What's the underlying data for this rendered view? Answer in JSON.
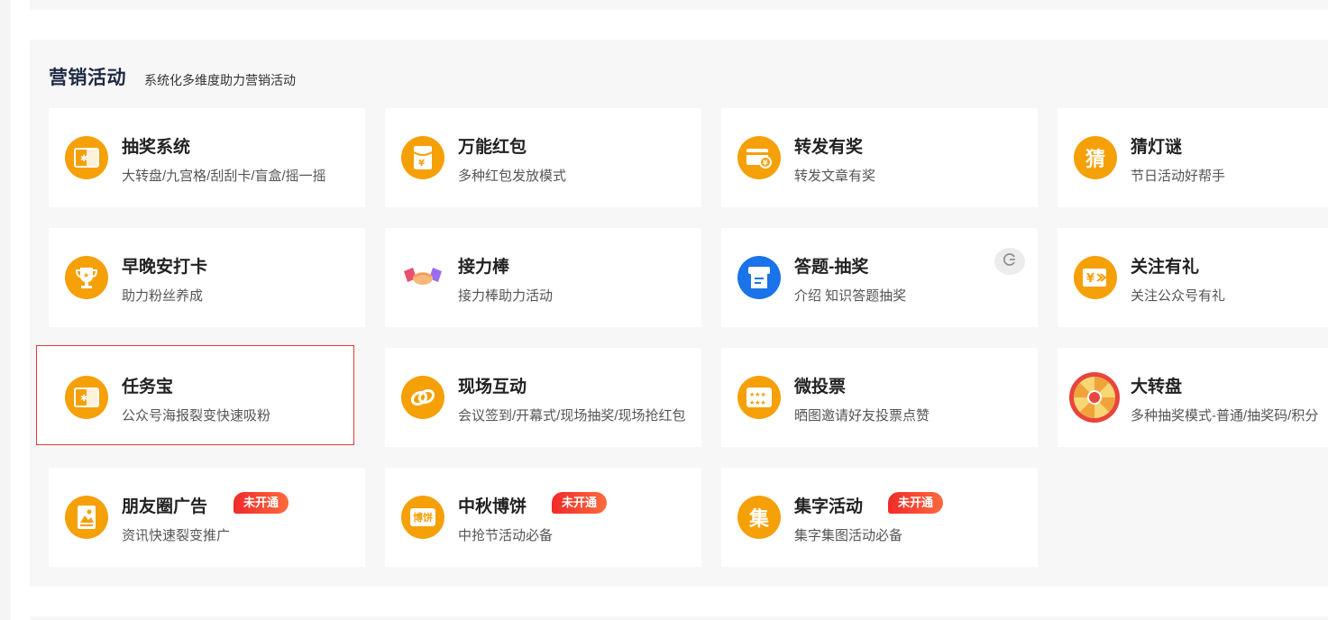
{
  "section": {
    "title": "营销活动",
    "subtitle": "系统化多维度助力营销活动"
  },
  "colors": {
    "accent": "#f5a007",
    "badge": "#f02a2a",
    "title_text": "#1f2a44"
  },
  "cards": [
    {
      "title": "抽奖系统",
      "desc": "大转盘/九宫格/刮刮卡/盲盒/摇一摇",
      "icon": "ticket-icon"
    },
    {
      "title": "万能红包",
      "desc": "多种红包发放模式",
      "icon": "red-envelope-icon"
    },
    {
      "title": "转发有奖",
      "desc": "转发文章有奖",
      "icon": "share-card-icon"
    },
    {
      "title": "猜灯谜",
      "desc": "节日活动好帮手",
      "icon": "riddle-icon",
      "icon_char": "猜"
    },
    {
      "title": "早晚安打卡",
      "desc": "助力粉丝养成",
      "icon": "trophy-icon"
    },
    {
      "title": "接力棒",
      "desc": "接力棒助力活动",
      "icon": "handshake-icon"
    },
    {
      "title": "答题-抽奖",
      "desc": "介绍 知识答题抽奖",
      "icon": "quiz-icon"
    },
    {
      "title": "关注有礼",
      "desc": "关注公众号有礼",
      "icon": "gift-yen-icon"
    },
    {
      "title": "任务宝",
      "desc": "公众号海报裂变快速吸粉",
      "icon": "ticket-icon"
    },
    {
      "title": "现场互动",
      "desc": "会议签到/开幕式/现场抽奖/现场抢红包",
      "icon": "link-icon"
    },
    {
      "title": "微投票",
      "desc": "晒图邀请好友投票点赞",
      "icon": "vote-icon"
    },
    {
      "title": "大转盘",
      "desc": "多种抽奖模式-普通/抽奖码/积分",
      "icon": "wheel-icon"
    },
    {
      "title": "朋友圈广告",
      "desc": "资讯快速裂变推广",
      "icon": "poster-icon",
      "badge": "未开通"
    },
    {
      "title": "中秋博饼",
      "desc": "中抢节活动必备",
      "icon": "mooncake-icon",
      "badge": "未开通",
      "icon_text": "博饼"
    },
    {
      "title": "集字活动",
      "desc": "集字集图活动必备",
      "icon": "collect-icon",
      "badge": "未开通",
      "icon_char": "集"
    }
  ]
}
